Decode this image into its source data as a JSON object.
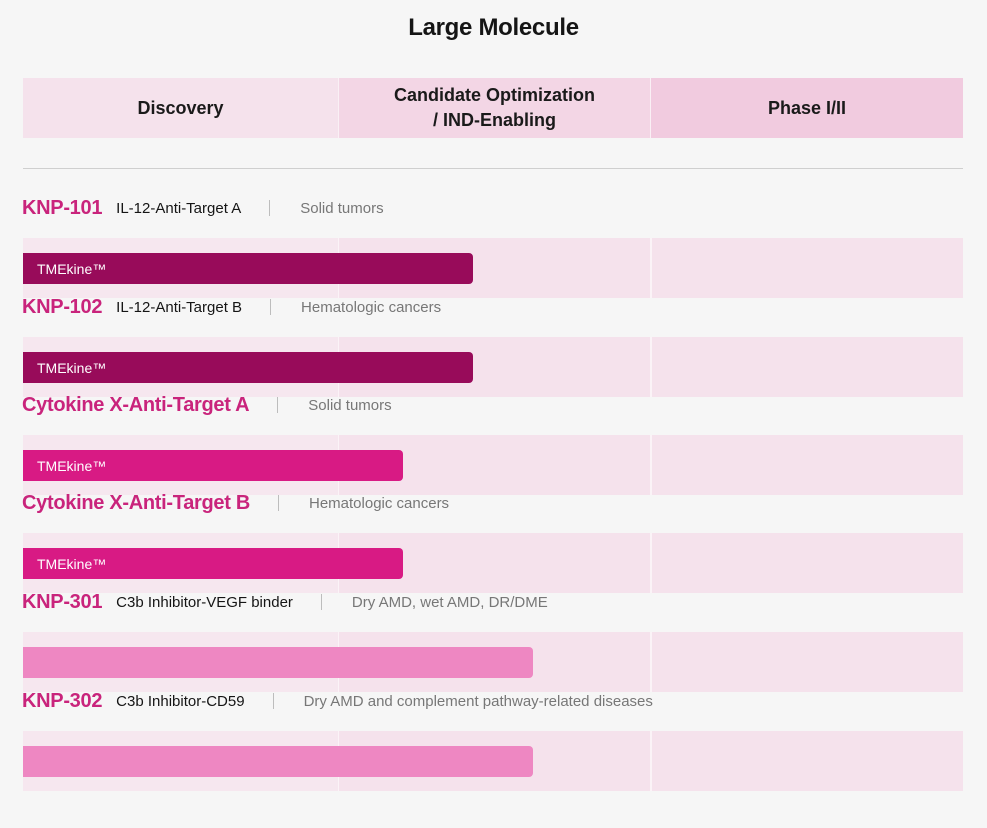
{
  "title": "Large Molecule",
  "columns": {
    "discovery": "Discovery",
    "candidate_line1": "Candidate Optimization",
    "candidate_line2": "/ IND-Enabling",
    "phase": "Phase I/II"
  },
  "colors": {
    "accent": "#c9247c",
    "bar_dark": "#980b5a",
    "bar_mid": "#d81a84",
    "bar_light": "#ee87c2"
  },
  "programs": [
    {
      "code": "KNP-101",
      "target": "IL-12-Anti-Target A",
      "indication": "Solid tumors",
      "platform": "TMEkine™",
      "progress_stage": "Candidate Optimization / IND-Enabling"
    },
    {
      "code": "KNP-102",
      "target": "IL-12-Anti-Target B",
      "indication": "Hematologic cancers",
      "platform": "TMEkine™",
      "progress_stage": "Candidate Optimization / IND-Enabling"
    },
    {
      "code": "Cytokine X-Anti-Target A",
      "target": "",
      "indication": "Solid tumors",
      "platform": "TMEkine™",
      "progress_stage": "Candidate Optimization / IND-Enabling"
    },
    {
      "code": "Cytokine X-Anti-Target B",
      "target": "",
      "indication": "Hematologic cancers",
      "platform": "TMEkine™",
      "progress_stage": "Candidate Optimization / IND-Enabling"
    },
    {
      "code": "KNP-301",
      "target": "C3b Inhibitor-VEGF binder",
      "indication": "Dry AMD, wet AMD, DR/DME",
      "platform": "",
      "progress_stage": "Candidate Optimization / IND-Enabling"
    },
    {
      "code": "KNP-302",
      "target": "C3b Inhibitor-CD59",
      "indication": "Dry AMD and complement pathway-related diseases",
      "platform": "",
      "progress_stage": "Candidate Optimization / IND-Enabling"
    }
  ]
}
